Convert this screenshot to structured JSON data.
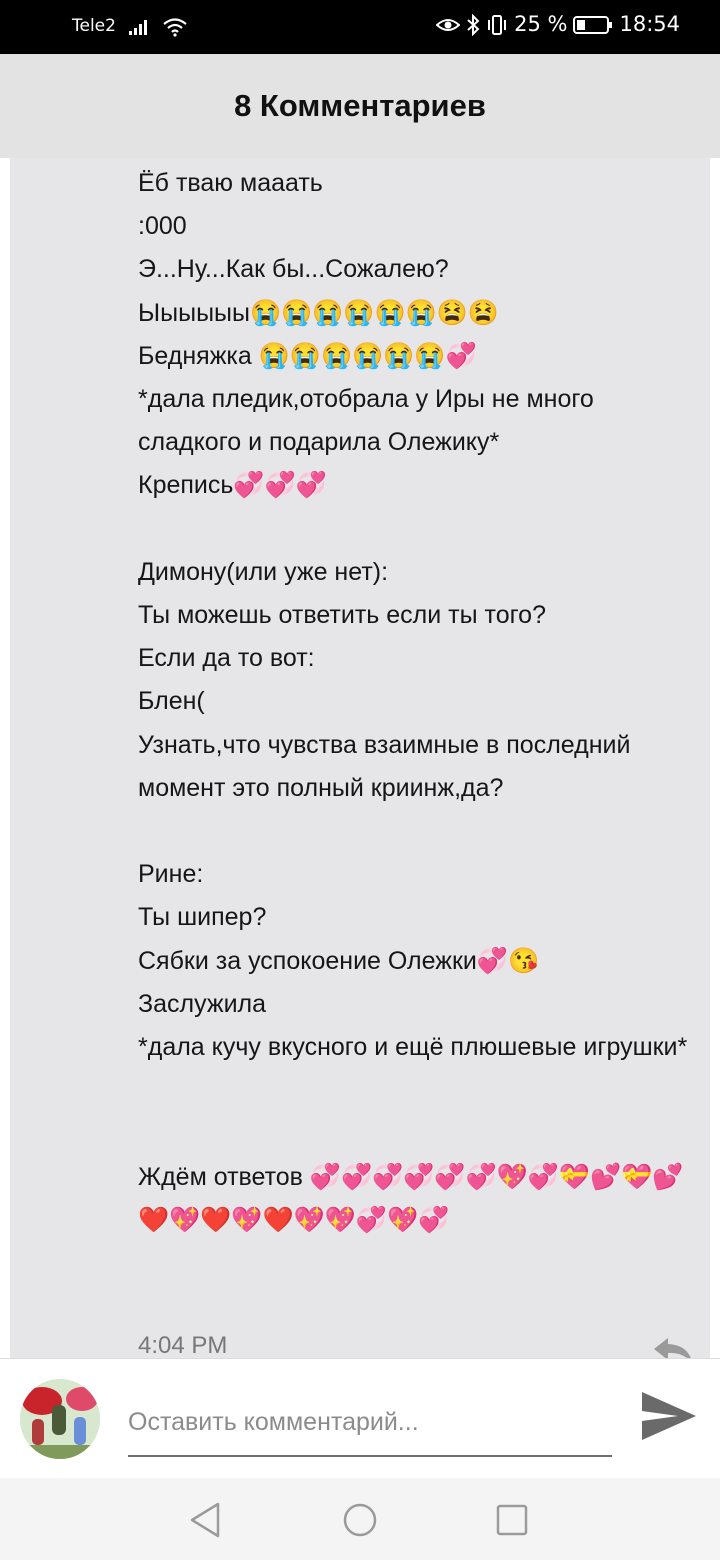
{
  "status_bar": {
    "carrier": "Tele2",
    "battery": "25 %",
    "time": "18:54"
  },
  "header": {
    "title": "8 Комментариев"
  },
  "comment": {
    "text": "Ёб тваю мааать\n:000\nЭ...Ну...Как бы...Сожалею?\nЫыыыыы😭😭😭😭😭😭😫😫\nБедняжка 😭😭😭😭😭😭💞\n*дала пледик,отобрала у Иры не много сладкого и подарила Олежику*\nКрепись💞💞💞\n\nДимону(или уже нет):\nТы можешь ответить если ты того?\nЕсли да то вот:\nБлен(\nУзнать,что чувства взаимные в последний момент это полный криинж,да?\n\nРине:\nТы шипер?\nСябки за успокоение Олежки💞😘\nЗаслужила\n*дала кучу вкусного и ещё плюшевые игрушки*\n\n\nЖдём ответов 💞💞💞💞💞💞💖💞💝💕💝💕❤️💖❤️💖❤️💖💖💞💖💞",
    "time": "4:04 PM"
  },
  "input": {
    "placeholder": "Оставить комментарий..."
  },
  "icons": {
    "signal": "signal-bars-icon",
    "wifi": "wifi-icon",
    "eye": "eye-comfort-icon",
    "bluetooth": "bluetooth-icon",
    "vibrate": "vibrate-icon",
    "battery": "battery-icon",
    "reply": "reply-icon",
    "send": "send-icon",
    "nav_back": "nav-back-icon",
    "nav_home": "nav-home-icon",
    "nav_recents": "nav-recents-icon"
  },
  "colors": {
    "header_bg": "#e3e3e3",
    "card_bg": "#e6e5e7",
    "send_icon": "#6a6a6a"
  }
}
